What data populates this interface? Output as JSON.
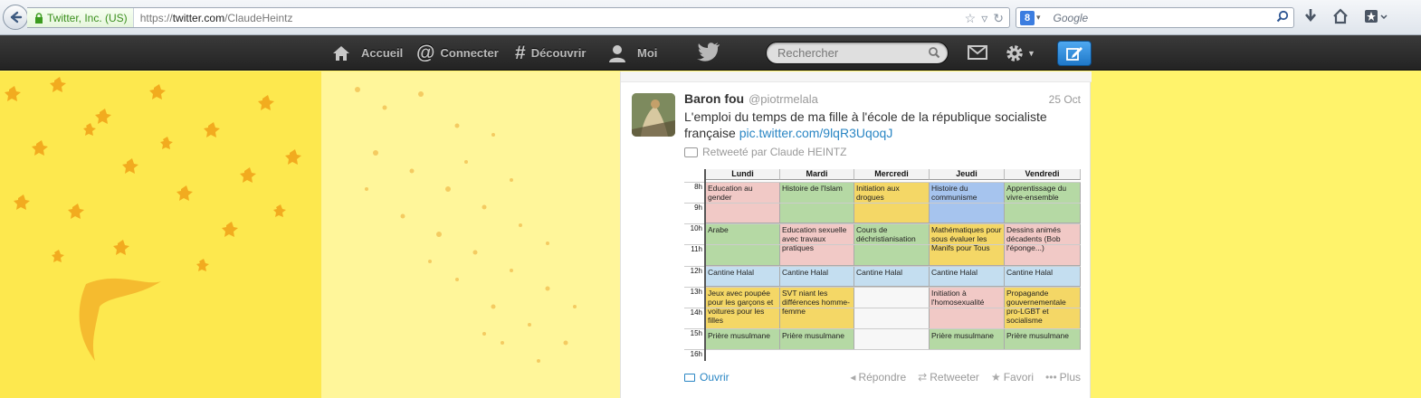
{
  "browser": {
    "identity": "Twitter, Inc. (US)",
    "url_prefix": "https://",
    "url_domain": "twitter.com",
    "url_path": "/ClaudeHeintz",
    "search_placeholder": "Google",
    "search_engine_badge": "8"
  },
  "topbar": {
    "nav": [
      {
        "label": "Accueil",
        "icon": "home-icon"
      },
      {
        "label": "Connecter",
        "icon": "at-icon"
      },
      {
        "label": "Découvrir",
        "icon": "hash-icon"
      },
      {
        "label": "Moi",
        "icon": "person-icon"
      }
    ],
    "search_placeholder": "Rechercher"
  },
  "tweet": {
    "fullname": "Baron fou",
    "username": "@piotrmelala",
    "time": "25 Oct",
    "text": "L'emploi du temps de ma fille à l'école de la république socialiste française",
    "link": "pic.twitter.com/9lqR3UqoqJ",
    "retweeted_by": "Retweeté par Claude HEINTZ",
    "timetable": {
      "days": [
        "Lundi",
        "Mardi",
        "Mercredi",
        "Jeudi",
        "Vendredi"
      ],
      "hours": [
        "8h",
        "9h",
        "10h",
        "11h",
        "12h",
        "13h",
        "14h",
        "15h",
        "16h"
      ],
      "rows": [
        [
          "Education au gender",
          "Histoire de l'Islam",
          "Initiation aux drogues",
          "Histoire du communisme",
          "Apprentissage du vivre-ensemble"
        ],
        [
          "Arabe",
          "Education sexuelle avec travaux pratiques",
          "Cours de déchristianisation",
          "Mathématiques pour sous évaluer les Manifs pour Tous",
          "Dessins animés décadents (Bob l'éponge...)"
        ],
        [
          "Cantine Halal",
          "Cantine Halal",
          "Cantine Halal",
          "Cantine Halal",
          "Cantine Halal"
        ],
        [
          "Jeux avec poupée pour les garçons et voitures pour les filles",
          "SVT niant les différences homme-femme",
          "",
          "Initiation à l'homosexualité",
          "Propagande gouvernementale pro-LGBT et socialisme"
        ],
        [
          "Prière musulmane",
          "Prière musulmane",
          "",
          "Prière musulmane",
          "Prière musulmane"
        ]
      ]
    },
    "actions": {
      "open": "Ouvrir",
      "reply": "Répondre",
      "retweet": "Retweeter",
      "favorite": "Favori",
      "more": "Plus"
    }
  },
  "colors": {
    "topbar": "#2b2b2b",
    "link": "#2a86c4",
    "background_yellow": "#fde84e",
    "compose_button": "#2f8cdc"
  }
}
